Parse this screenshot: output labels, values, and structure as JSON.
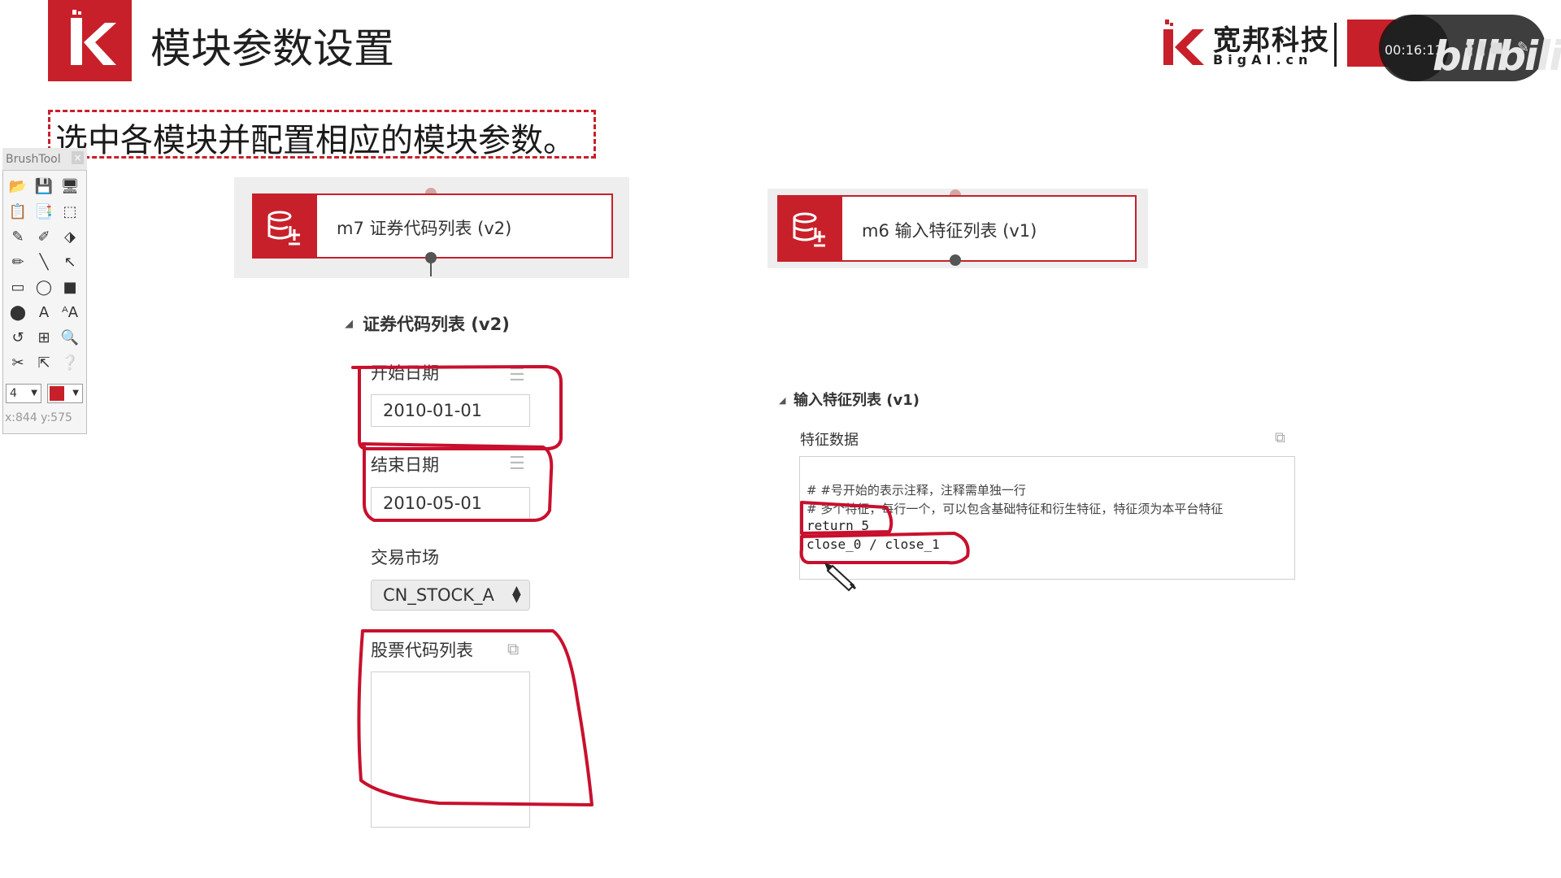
{
  "header": {
    "title": "模块参数设置",
    "brand_name": "宽邦科技",
    "brand_sub": "BigAI.cn",
    "timestamp": "00:16:11",
    "watermark": "bilibili"
  },
  "subtitle": "选中各模块并配置相应的模块参数。",
  "brush_tool": {
    "title": "BrushTool",
    "close": "×",
    "size": "4",
    "coords": "x:844   y:575",
    "tools": [
      "📂",
      "💾",
      "🖥",
      "📋",
      "📑",
      "⬚",
      "✎",
      "✐",
      "⬗",
      "✏",
      "╲",
      "↖",
      "▭",
      "◯",
      "■",
      "⬤",
      "A",
      "ᴬA",
      "↺",
      "⊞",
      "🔍",
      "✂",
      "⇱",
      "❔"
    ]
  },
  "modules": [
    {
      "label": "m7 证券代码列表 (v2)"
    },
    {
      "label": "m6 输入特征列表 (v1)"
    }
  ],
  "left_panel": {
    "section_title": "证券代码列表 (v2)",
    "start_date_label": "开始日期",
    "start_date_value": "2010-01-01",
    "end_date_label": "结束日期",
    "end_date_value": "2010-05-01",
    "market_label": "交易市场",
    "market_value": "CN_STOCK_A",
    "instruments_label": "股票代码列表",
    "instruments_value": ""
  },
  "right_panel": {
    "section_title": "输入特征列表 (v1)",
    "feature_label": "特征数据",
    "code_lines": [
      "# #号开始的表示注释，注释需单独一行",
      "# 多个特征，每行一个，可以包含基础特征和衍生特征，特征须为本平台特征",
      "return_5",
      "close_0 / close_1"
    ]
  },
  "colors": {
    "accent": "#c8202a",
    "annotation": "#c8102e"
  },
  "icons": [
    "logo-k-icon",
    "database-add-icon",
    "menu-lines-icon",
    "expand-icon",
    "select-arrows-icon",
    "collapse-triangle-icon",
    "pencil-cursor-icon"
  ]
}
